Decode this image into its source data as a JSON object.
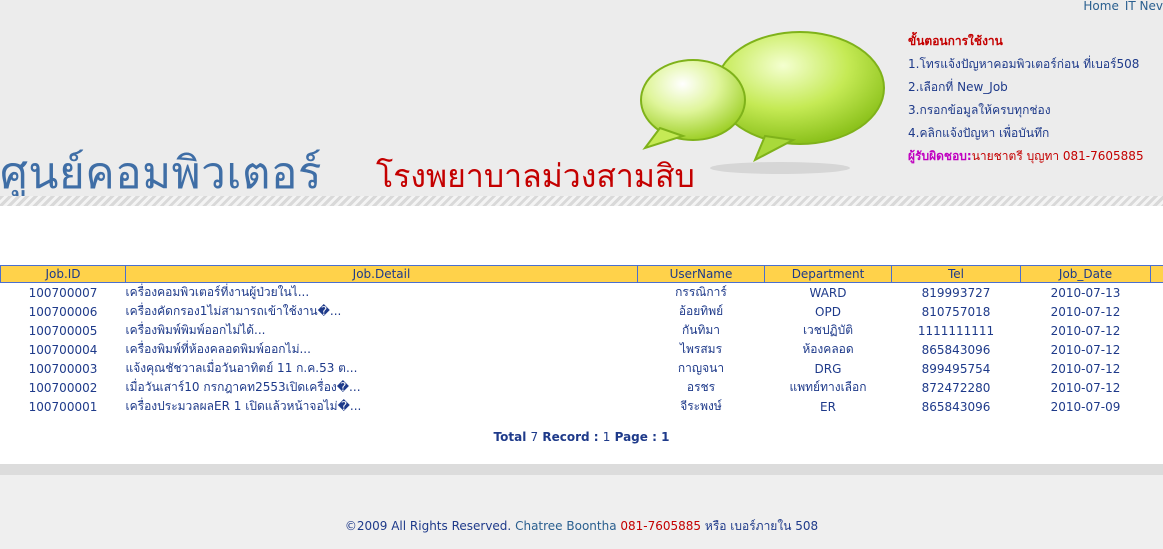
{
  "topnav": {
    "home": "Home",
    "it_news": "IT Nev"
  },
  "header": {
    "title": "ศูนย์คอมพิวเตอร์",
    "hospital": "โรงพยาบาลม่วงสามสิบ"
  },
  "steps": {
    "title": "ขั้นตอนการใช้งาน",
    "items": [
      "1.โทรแจ้งปัญหาคอมพิวเตอร์ก่อน ที่เบอร์508",
      "2.เลือกที่ New_Job",
      "3.กรอกข้อมูลให้ครบทุกช่อง",
      "4.คลิกแจ้งปัญหา เพื่อบันทึก"
    ],
    "responsible_label": "ผู้รับผิดชอบ:",
    "responsible_value": "นายชาตรี บุญทา 081-7605885"
  },
  "table": {
    "headers": [
      "Job.ID",
      "Job.Detail",
      "UserName",
      "Department",
      "Tel",
      "Job_Date"
    ],
    "rows": [
      {
        "id": "100700007",
        "detail": "เครื่องคอมพิวเตอร์ที่งานผู้ป่วยในไ...",
        "user": "กรรณิการ์",
        "dept": "WARD",
        "tel": "819993727",
        "date": "2010-07-13"
      },
      {
        "id": "100700006",
        "detail": "เครื่องคัดกรอง1ไม่สามารถเข้าใช้งาน�...",
        "user": "อ้อยทิพย์",
        "dept": "OPD",
        "tel": "810757018",
        "date": "2010-07-12"
      },
      {
        "id": "100700005",
        "detail": "เครื่องพิมพ์พิมพ์ออกไม่ได้...",
        "user": "กันทิมา",
        "dept": "เวชปฏิบัติ",
        "tel": "1111111111",
        "date": "2010-07-12"
      },
      {
        "id": "100700004",
        "detail": "เครื่องพิมพ์ที่ห้องคลอดพิมพ์ออกไม่...",
        "user": "ไพรสมร",
        "dept": "ห้องคลอด",
        "tel": "865843096",
        "date": "2010-07-12"
      },
      {
        "id": "100700003",
        "detail": "แจ้งคุณชัชวาลเมื่อวันอาทิตย์ 11 ก.ค.53 ต...",
        "user": "กาญจนา",
        "dept": "DRG",
        "tel": "899495754",
        "date": "2010-07-12"
      },
      {
        "id": "100700002",
        "detail": "เมื่อวันเสาร์10 กรกฎาคท2553เปิดเครื่อง�...",
        "user": "อรชร",
        "dept": "แพทย์ทางเลือก",
        "tel": "872472280",
        "date": "2010-07-12"
      },
      {
        "id": "100700001",
        "detail": "เครื่องประมวลผลER 1 เปิดแล้วหน้าจอไม่�...",
        "user": "จีระพงษ์",
        "dept": "ER",
        "tel": "865843096",
        "date": "2010-07-09"
      }
    ]
  },
  "summary": {
    "total_label": "Total",
    "total_count": "7",
    "record_label": "Record :",
    "page_count": "1",
    "page_label": "Page :",
    "page_current": "1"
  },
  "footer": {
    "copyright": "©2009 All Rights Reserved.",
    "name": "Chatree Boontha",
    "phone": "081-7605885",
    "extension": "หรือ เบอร์ภายใน 508"
  }
}
